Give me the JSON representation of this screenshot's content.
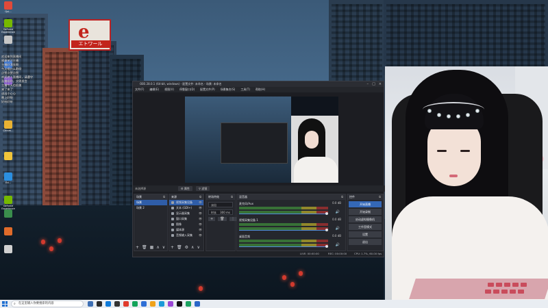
{
  "desktop": {
    "icons": [
      {
        "label": "Qui...",
        "color": "#e04a3a"
      },
      {
        "label": "GeForce Experience",
        "color": "#76b900"
      },
      {
        "label": "",
        "color": "#c7c7c7"
      },
      {
        "label": "",
        "color": "#3b78d8"
      },
      {
        "label": "",
        "color": "#8c5bd6"
      },
      {
        "label": "Chrom...",
        "color": "#e9b233"
      },
      {
        "label": "",
        "color": "#f0c43a"
      },
      {
        "label": "Ed...",
        "color": "#2b8fe0"
      },
      {
        "label": "GeForce Experience",
        "color": "#76b900"
      },
      {
        "label": "",
        "color": "#3a8d4c"
      },
      {
        "label": "",
        "color": "#e06b2a"
      },
      {
        "label": "",
        "color": "#d0d0d0"
      }
    ],
    "billboard": {
      "char": "e",
      "text": "エトワール"
    }
  },
  "chat": [
    {
      "name": "",
      "text": "欢迎来到直播间"
    },
    {
      "name": "",
      "text": "感谢关注主播"
    },
    {
      "name": "",
      "text": "主播好漂亮啊"
    },
    {
      "name": "",
      "text": "今天唱什么歌呀"
    },
    {
      "name": "",
      "text": "点赞点赞点赞"
    },
    {
      "name": "",
      "text": "欢迎进入直播间，请遵守"
    },
    {
      "name": "",
      "text": "直播规则，文明发言"
    },
    {
      "name": "",
      "text": "主播今天也很美"
    },
    {
      "name": "",
      "text": "来了来了"
    },
    {
      "name": "",
      "text": "送出小心心"
    },
    {
      "name": "",
      "text": "晚上好呀"
    },
    {
      "name": "",
      "text": "好听好听"
    }
  ],
  "obs": {
    "title": "OBS 28.0.1 (64-bit, windows) - 配置文件: 未命名 - 场景: 未命名",
    "menu": [
      "文件(F)",
      "编辑(E)",
      "视图(V)",
      "停靠窗口(D)",
      "配置文件(P)",
      "场景集合(S)",
      "工具(T)",
      "帮助(H)"
    ],
    "scene_label": "未选择源",
    "properties_btn": "属性",
    "filters_btn": "滤镜",
    "docks": {
      "scenes": {
        "title": "场景",
        "items": [
          "场景",
          "场景 2"
        ]
      },
      "sources": {
        "title": "来源",
        "items": [
          "视频采集设备",
          "文本 (GDI+)",
          "显示器采集",
          "窗口采集",
          "图像",
          "媒体源",
          "音频输入采集"
        ]
      },
      "transitions": {
        "title": "转场特效",
        "type": "淡出",
        "duration_label": "时长",
        "duration": "300 ms"
      },
      "mixer": {
        "title": "混音器",
        "channels": [
          {
            "name": "麦克风/Aux",
            "db": "0.0 dB"
          },
          {
            "name": "视频采集设备 1",
            "db": "0.0 dB"
          },
          {
            "name": "桌面音频",
            "db": "0.0 dB"
          }
        ]
      },
      "controls": {
        "title": "控件",
        "buttons": [
          "开始直播",
          "开始录制",
          "启动虚拟摄像机",
          "工作室模式",
          "设置",
          "退出"
        ]
      }
    },
    "status": {
      "live": "LIVE: 00:00:00",
      "rec": "REC: 00:00:00",
      "cpu": "CPU: 1.7%, 60.00 fps"
    }
  },
  "taskbar": {
    "search_placeholder": "在这里输入你要搜索的内容",
    "apps": [
      {
        "color": "#3d6fb4"
      },
      {
        "color": "#2b2b2b"
      },
      {
        "color": "#0f7ad9"
      },
      {
        "color": "#333333"
      },
      {
        "color": "#e03c2e"
      },
      {
        "color": "#12a35a"
      },
      {
        "color": "#2f6fd6"
      },
      {
        "color": "#f0a21a"
      },
      {
        "color": "#1b9bd8"
      },
      {
        "color": "#9a47d6"
      },
      {
        "color": "#111111"
      },
      {
        "color": "#1aa260"
      },
      {
        "color": "#2a66c8"
      }
    ]
  }
}
